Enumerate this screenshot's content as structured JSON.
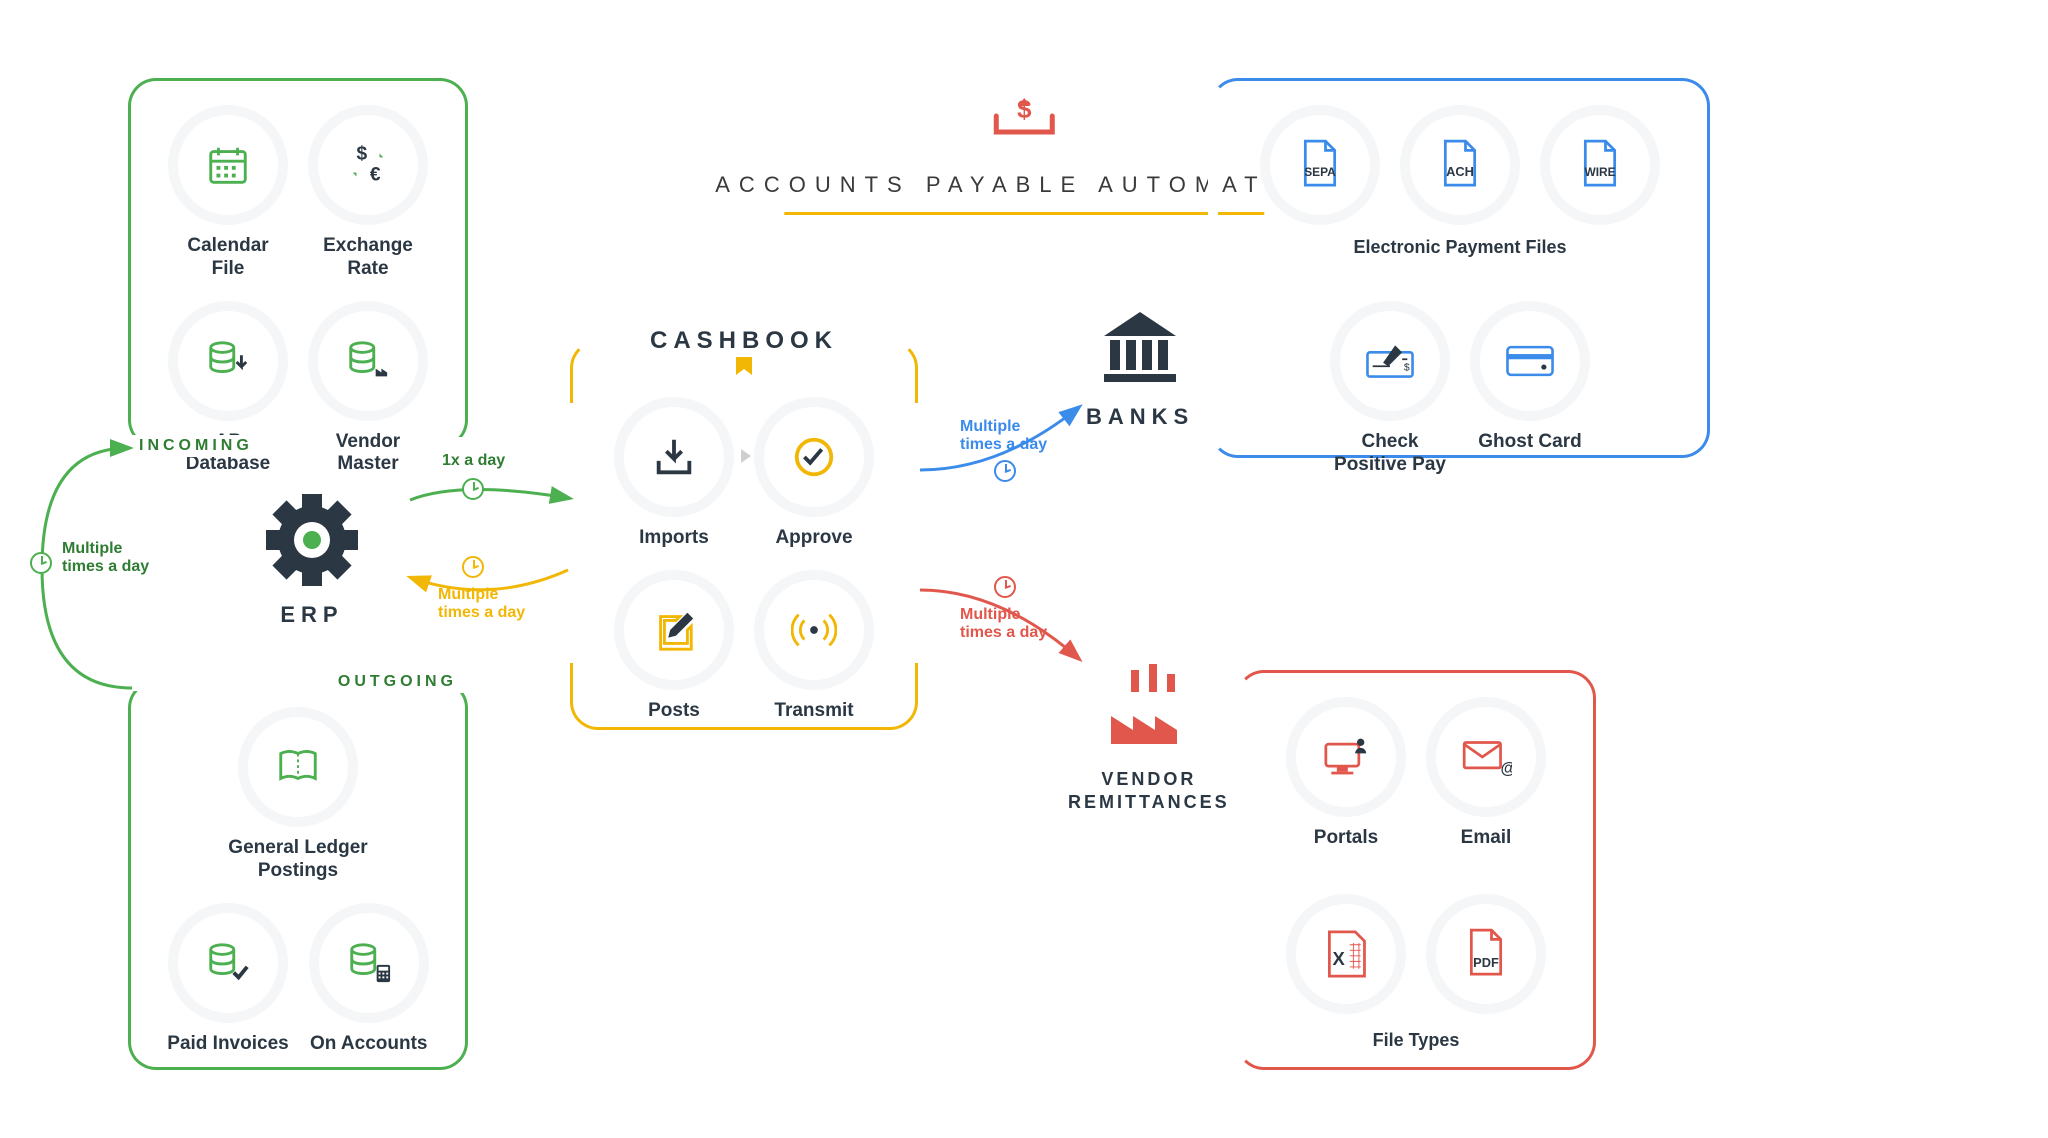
{
  "hero": {
    "title": "ACCOUNTS PAYABLE AUTOMATION"
  },
  "erp": {
    "label": "ERP",
    "incoming": {
      "badge": "INCOMING",
      "items": [
        {
          "id": "calendar-file",
          "label": "Calendar\nFile"
        },
        {
          "id": "exchange-rate",
          "label": "Exchange\nRate"
        },
        {
          "id": "ap-database",
          "label": "AP\nDatabase"
        },
        {
          "id": "vendor-master",
          "label": "Vendor\nMaster"
        }
      ]
    },
    "outgoing": {
      "badge": "OUTGOING",
      "items": [
        {
          "id": "gl-postings",
          "label": "General Ledger\nPostings"
        },
        {
          "id": "paid-invoices",
          "label": "Paid Invoices"
        },
        {
          "id": "on-accounts",
          "label": "On Accounts"
        }
      ]
    },
    "loopLabel": "Multiple\ntimes a day"
  },
  "cashbook": {
    "title": "CASHBOOK",
    "items": [
      {
        "id": "imports",
        "label": "Imports"
      },
      {
        "id": "approve",
        "label": "Approve"
      },
      {
        "id": "posts",
        "label": "Posts"
      },
      {
        "id": "transmit",
        "label": "Transmit"
      }
    ]
  },
  "arrows": {
    "erp_to_cashbook": "1x  a day",
    "cashbook_to_erp": "Multiple\ntimes a day",
    "cashbook_to_banks": "Multiple\ntimes a day",
    "cashbook_to_vendors": "Multiple\ntimes a day"
  },
  "banks": {
    "label": "BANKS",
    "row1_caption": "Electronic Payment Files",
    "files": [
      {
        "id": "sepa",
        "label": "SEPA"
      },
      {
        "id": "ach",
        "label": "ACH"
      },
      {
        "id": "wire",
        "label": "WIRE"
      }
    ],
    "row2": [
      {
        "id": "check-positive-pay",
        "label": "Check\nPositive Pay"
      },
      {
        "id": "ghost-card",
        "label": "Ghost Card"
      }
    ]
  },
  "vendors": {
    "label": "VENDOR\nREMITTANCES",
    "row1": [
      {
        "id": "portals",
        "label": "Portals"
      },
      {
        "id": "email",
        "label": "Email"
      }
    ],
    "row2_caption": "File Types",
    "row2": [
      {
        "id": "excel",
        "label": "X"
      },
      {
        "id": "pdf",
        "label": "PDF"
      }
    ]
  }
}
